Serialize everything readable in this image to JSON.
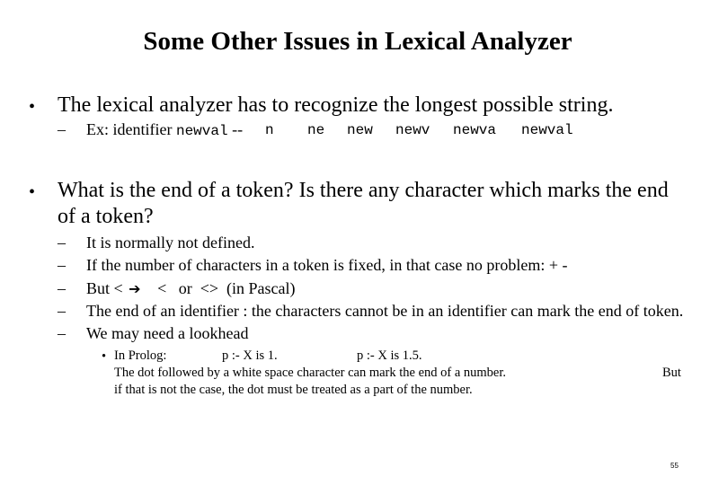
{
  "slide": {
    "title": "Some Other Issues in Lexical Analyzer",
    "bullet1": {
      "text": "The lexical analyzer has to recognize the longest possible string.",
      "sub": {
        "prefix": "Ex:  identifier",
        "identifier": "newval",
        "sep": "--",
        "sequence": [
          "n",
          "ne",
          "new",
          "newv",
          "newva",
          "newval"
        ]
      }
    },
    "bullet2": {
      "line1": "What is the end of a token? Is there any character which marks the end",
      "line2": "of a token?",
      "subs": [
        "It is normally not defined.",
        "If the number of characters in a token is fixed, in that case no problem:  + -",
        "The end of an identifier : the characters cannot be in an identifier can mark the end of token.",
        "We may need a lookhead"
      ],
      "pascal": {
        "prefix": "But <",
        "arrow_icon": "right-arrow",
        "rest": "<   or  <>  (in Pascal)"
      },
      "prolog": {
        "label": "In Prolog:",
        "ex1": "p :- X is 1.",
        "ex2": "p :- X is 1.5.",
        "line2": "The dot  followed by a white space character can mark the end of a number.",
        "line2_tail": "But",
        "line3": "if that is not the case, the dot must be treated as a part of the number."
      }
    },
    "page_number": "55"
  }
}
